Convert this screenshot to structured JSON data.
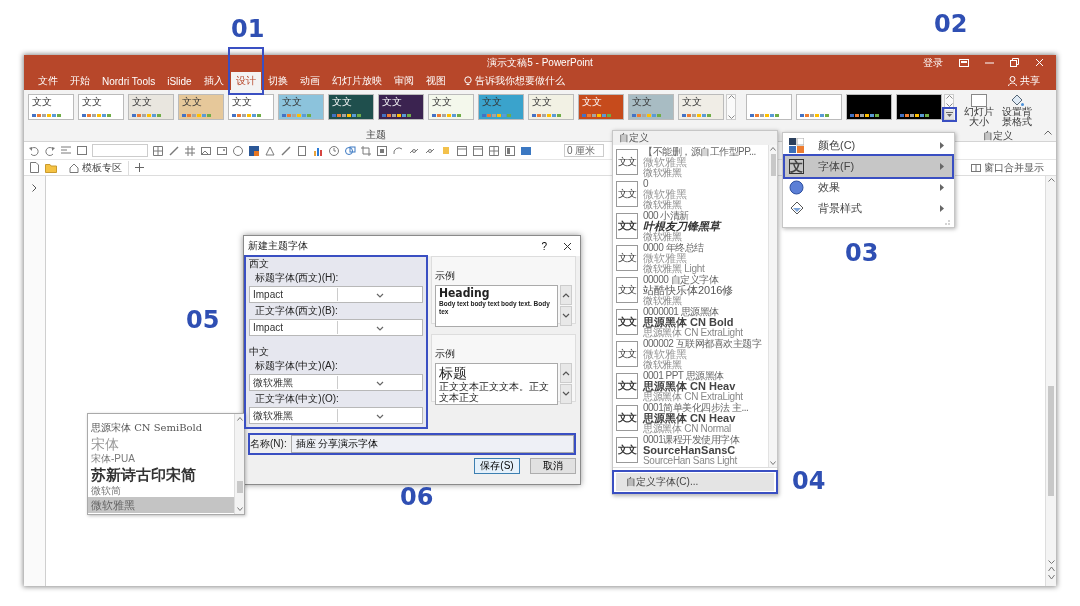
{
  "annotations": [
    {
      "label": "01"
    },
    {
      "label": "02"
    },
    {
      "label": "03"
    },
    {
      "label": "04"
    },
    {
      "label": "05"
    },
    {
      "label": "06"
    }
  ],
  "window": {
    "title": "演示文稿5 - PowerPoint",
    "sign_in": "登录",
    "share": "共享"
  },
  "tabs": [
    {
      "label": "文件",
      "selected": false
    },
    {
      "label": "开始",
      "selected": false
    },
    {
      "label": "Nordri Tools",
      "selected": false
    },
    {
      "label": "iSlide",
      "selected": false
    },
    {
      "label": "插入",
      "selected": false
    },
    {
      "label": "设计",
      "selected": true
    },
    {
      "label": "切换",
      "selected": false
    },
    {
      "label": "动画",
      "selected": false
    },
    {
      "label": "幻灯片放映",
      "selected": false
    },
    {
      "label": "审阅",
      "selected": false
    },
    {
      "label": "视图",
      "selected": false
    }
  ],
  "tell_me": "告诉我你想要做什么",
  "ribbon": {
    "themes": [
      {
        "label": "文文",
        "color": "#ffffff"
      },
      {
        "label": "文文",
        "color": "#ffffff"
      },
      {
        "label": "文文",
        "color": "#e9e6df"
      },
      {
        "label": "文文",
        "color": "#e6c89a"
      },
      {
        "label": "文文",
        "color": "#ffffff"
      },
      {
        "label": "文文",
        "color": "#8cc3dc"
      },
      {
        "label": "文文",
        "color": "#1f4f4d"
      },
      {
        "label": "文文",
        "color": "#3b2350"
      },
      {
        "label": "文文",
        "color": "#f4f8ec"
      },
      {
        "label": "文文",
        "color": "#3aa3cc"
      },
      {
        "label": "文文",
        "color": "#f2f1e4"
      },
      {
        "label": "文文",
        "color": "#c64b1c"
      },
      {
        "label": "文文",
        "color": "#a8bcc3"
      },
      {
        "label": "文文",
        "color": "#f0ede6"
      }
    ],
    "themes_label": "主题",
    "variants": [
      {
        "color": "#ffffff"
      },
      {
        "color": "#ffffff"
      },
      {
        "color": "#000000"
      },
      {
        "color": "#000000"
      }
    ],
    "slide_size": "幻灯片大小",
    "format_background": "设置背景格式",
    "custom_label": "自定义"
  },
  "toolbar": {
    "spacing_value": "0 厘米"
  },
  "doc_tabs": {
    "home": "模板专区",
    "merge_windows": "窗口合并显示"
  },
  "dialog": {
    "title": "新建主题字体",
    "help": "?",
    "sections": [
      {
        "kind": "latin",
        "label": "西文",
        "fields": [
          {
            "label": "标题字体(西文)(H):",
            "value": "Impact"
          },
          {
            "label": "正文字体(西文)(B):",
            "value": "Impact"
          }
        ],
        "sample_label": "示例",
        "sample_heading": "Heading",
        "sample_body": "Body text body text body text. Body tex"
      },
      {
        "kind": "cjk",
        "label": "中文",
        "fields": [
          {
            "label": "标题字体(中文)(A):",
            "value": "微软雅黑"
          },
          {
            "label": "正文字体(中文)(O):",
            "value": "微软雅黑"
          }
        ],
        "sample_label": "示例",
        "sample_heading": "标题",
        "sample_body": "正文文本正文文本。正文文本正文"
      }
    ],
    "name_label": "名称(N):",
    "name_value": "插座 分享演示字体",
    "buttons": [
      {
        "label": "保存(S)",
        "default": true
      },
      {
        "label": "取消",
        "default": false
      }
    ]
  },
  "font_dropdown": {
    "items": [
      {
        "label": "思源宋体 CN SemiBold",
        "kind": "serif",
        "selected": false
      },
      {
        "label": "宋体",
        "kind": "large",
        "selected": false
      },
      {
        "label": "宋体-PUA",
        "kind": "small",
        "selected": false
      },
      {
        "label": "苏新诗古印宋简",
        "kind": "display",
        "selected": false
      },
      {
        "label": "微软简",
        "kind": "small",
        "selected": false
      },
      {
        "label": "微软雅黑",
        "kind": "regular",
        "selected": true
      }
    ]
  },
  "font_gallery": {
    "header": "自定义",
    "items": [
      {
        "preview": "文文",
        "kind": "light",
        "name": "【不能删，源自工作型PP...",
        "heading": "微软雅黑",
        "body": "微软雅黑"
      },
      {
        "preview": "文文",
        "kind": "light",
        "name": "0",
        "heading": "微软雅黑",
        "body": "微软雅黑"
      },
      {
        "preview": "文文",
        "kind": "script",
        "name": "000 小清新",
        "heading": "叶根友刀锋黑草",
        "body": "微软雅黑"
      },
      {
        "preview": "文文",
        "kind": "light",
        "name": "0000 年终总结",
        "heading": "微软雅黑",
        "body": "微软雅黑 Light"
      },
      {
        "preview": "文文",
        "kind": "regular",
        "name": "00000 自定义字体",
        "heading": "站酷快乐体2016修",
        "body": "微软雅黑"
      },
      {
        "preview": "文文",
        "kind": "bold",
        "name": "0000001 思源黑体",
        "heading": "思源黑体 CN Bold",
        "body": "思源黑体 CN ExtraLight"
      },
      {
        "preview": "文文",
        "kind": "light",
        "name": "000002 互联网都喜欢主题字",
        "heading": "微软雅黑",
        "body": "微软雅黑"
      },
      {
        "preview": "文文",
        "kind": "bold",
        "name": "0001 PPT 思源黑体",
        "heading": "思源黑体 CN Heav",
        "body": "思源黑体 CN ExtraLight"
      },
      {
        "preview": "文文",
        "kind": "bold",
        "name": "0001简单美化四步法 主...",
        "heading": "思源黑体 CN Heav",
        "body": "思源黑体 CN Normal"
      },
      {
        "preview": "文文",
        "kind": "bold",
        "name": "0001课程开发使用字体",
        "heading": "SourceHanSansC",
        "body": "SourceHan Sans Light"
      }
    ],
    "footer": "自定义字体(C)..."
  },
  "menu": [
    {
      "kind": "colors",
      "label": "颜色(C)",
      "selected": false
    },
    {
      "kind": "fonts",
      "icon": "文",
      "label": "字体(F)",
      "selected": true
    },
    {
      "kind": "effects",
      "label": "效果",
      "selected": false
    },
    {
      "kind": "background",
      "label": "背景样式",
      "selected": false
    }
  ]
}
